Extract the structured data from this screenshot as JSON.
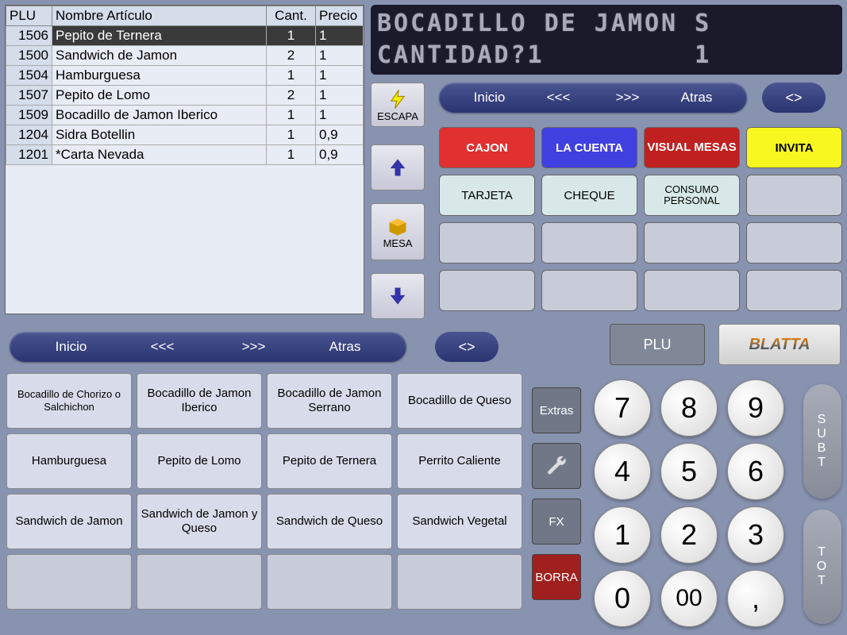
{
  "table": {
    "headers": [
      "PLU",
      "Nombre Artículo",
      "Cant.",
      "Precio"
    ],
    "rows": [
      {
        "plu": "1506",
        "name": "Pepito de Ternera",
        "qty": "1",
        "price": "1",
        "selected": true
      },
      {
        "plu": "1500",
        "name": "Sandwich de Jamon",
        "qty": "2",
        "price": "1"
      },
      {
        "plu": "1504",
        "name": "Hamburguesa",
        "qty": "1",
        "price": "1"
      },
      {
        "plu": "1507",
        "name": "Pepito de Lomo",
        "qty": "2",
        "price": "1"
      },
      {
        "plu": "1509",
        "name": "Bocadillo de Jamon Iberico",
        "qty": "1",
        "price": "1"
      },
      {
        "plu": "1204",
        "name": "Sidra Botellin",
        "qty": "1",
        "price": "0,9"
      },
      {
        "plu": "1201",
        "name": "*Carta Nevada",
        "qty": "1",
        "price": "0,9"
      }
    ]
  },
  "display": {
    "line1": "BOCADILLO DE JAMON S",
    "line2": "CANTIDAD?1         1"
  },
  "nav": {
    "inicio": "Inicio",
    "prev": "<<<",
    "next": ">>>",
    "atras": "Atras",
    "swap": "<>"
  },
  "side": {
    "escapa": "ESCAPA",
    "mesa": "MESA"
  },
  "actions": {
    "cajon": "CAJON",
    "cuenta": "LA CUENTA",
    "visual_mesas": "VISUAL MESAS",
    "invita": "INVITA",
    "tarjeta": "TARJETA",
    "cheque": "CHEQUE",
    "consumo": "CONSUMO PERSONAL"
  },
  "plu_label": "PLU",
  "logo": "BLATTA",
  "products": [
    [
      "Bocadillo de Chorizo o Salchichon",
      "Bocadillo de Jamon Iberico",
      "Bocadillo de Jamon Serrano",
      "Bocadillo de Queso"
    ],
    [
      "Hamburguesa",
      "Pepito de Lomo",
      "Pepito de Ternera",
      "Perrito Caliente"
    ],
    [
      "Sandwich de Jamon",
      "Sandwich de Jamon y Queso",
      "Sandwich de Queso",
      "Sandwich Vegetal"
    ],
    [
      "",
      "",
      "",
      ""
    ]
  ],
  "sidecol": {
    "extras": "Extras",
    "fx": "FX",
    "borra": "BORRA"
  },
  "keypad": {
    "k7": "7",
    "k8": "8",
    "k9": "9",
    "k4": "4",
    "k5": "5",
    "k6": "6",
    "k1": "1",
    "k2": "2",
    "k3": "3",
    "k0": "0",
    "k00": "00",
    "kc": ","
  },
  "subt": "SUBT",
  "tot": "TOT"
}
